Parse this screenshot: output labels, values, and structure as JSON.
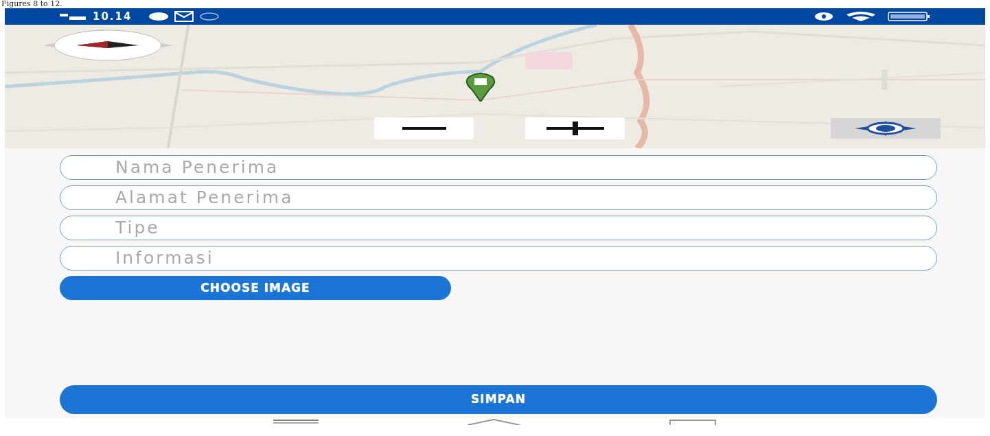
{
  "caption": "Figures 8 to 12.",
  "status_bar": {
    "time": "10.14"
  },
  "fields": [
    {
      "placeholder": "Nama Penerima"
    },
    {
      "placeholder": "Alamat Penerima"
    },
    {
      "placeholder": "Tipe"
    },
    {
      "placeholder": "Informasi"
    }
  ],
  "buttons": {
    "choose_image": "CHOOSE IMAGE",
    "save": "SIMPAN"
  }
}
